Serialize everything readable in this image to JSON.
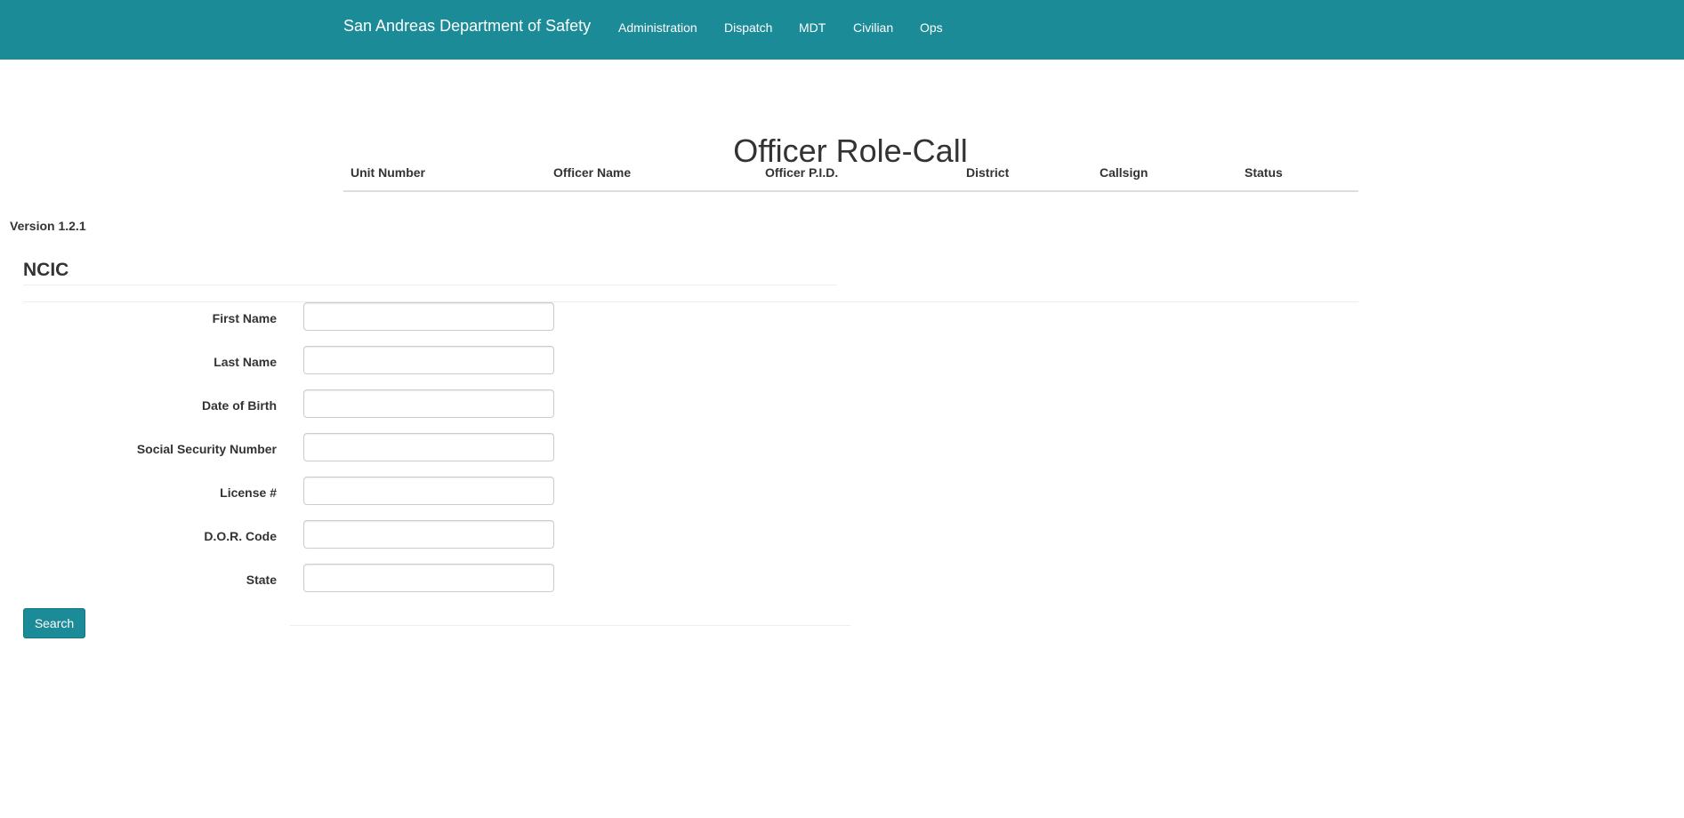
{
  "navbar": {
    "brand": "San Andreas Department of Safety",
    "links": [
      "Administration",
      "Dispatch",
      "MDT",
      "Civilian",
      "Ops"
    ],
    "background": "#1b8b98"
  },
  "roster": {
    "title": "Officer Role-Call",
    "columns": [
      "Unit Number",
      "Officer Name",
      "Officer P.I.D.",
      "District",
      "Callsign",
      "Status"
    ],
    "rows": []
  },
  "version": "Version 1.2.1",
  "ncic": {
    "title": "NCIC",
    "fields": [
      {
        "label": "First Name",
        "value": ""
      },
      {
        "label": "Last Name",
        "value": ""
      },
      {
        "label": "Date of Birth",
        "value": ""
      },
      {
        "label": "Social Security Number",
        "value": ""
      },
      {
        "label": "License #",
        "value": ""
      },
      {
        "label": "D.O.R. Code",
        "value": ""
      },
      {
        "label": "State",
        "value": ""
      }
    ],
    "search_label": "Search"
  }
}
